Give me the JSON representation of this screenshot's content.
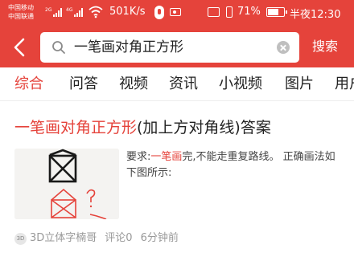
{
  "status_bar": {
    "carrier_1": "中国移动",
    "carrier_2": "中国联通",
    "network_type_1": "2G",
    "network_type_2": "4G",
    "net_speed": "501K/s",
    "battery_percent": "71%",
    "time": "半夜12:30"
  },
  "search": {
    "query": "一笔画对角正方形",
    "submit_label": "搜索"
  },
  "tabs": [
    {
      "label": "综合",
      "active": true
    },
    {
      "label": "问答",
      "active": false
    },
    {
      "label": "视频",
      "active": false
    },
    {
      "label": "资讯",
      "active": false
    },
    {
      "label": "小视频",
      "active": false
    },
    {
      "label": "图片",
      "active": false
    },
    {
      "label": "用户",
      "active": false
    }
  ],
  "result": {
    "title_highlight": "一笔画对角正方形",
    "title_rest": "(加上方对角线)答案",
    "snippet_before": "要求:",
    "snippet_highlight": "一笔画",
    "snippet_after": "完,不能走重复路线。 正确画法如下图所示:",
    "source_icon_text": "3D",
    "source": "3D立体字楠哥",
    "comments": "评论0",
    "time_ago": "6分钟前"
  },
  "colors": {
    "accent": "#e5433b",
    "text_primary": "#222222",
    "text_meta": "#999999"
  }
}
